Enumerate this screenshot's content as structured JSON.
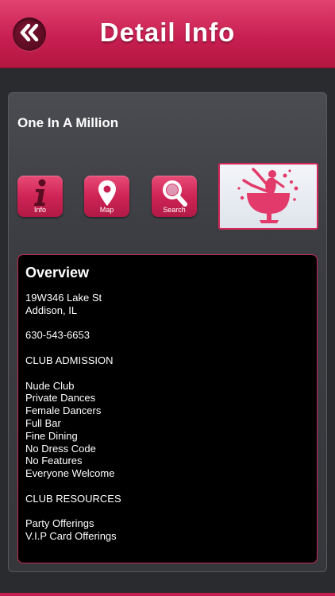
{
  "header": {
    "title": "Detail Info"
  },
  "club": {
    "name": "One In A Million"
  },
  "actions": {
    "info_label": "Info",
    "map_label": "Map",
    "search_label": "Search"
  },
  "icons": {
    "back": "double-chevron-left-icon",
    "info": "info-icon",
    "map": "map-pin-icon",
    "search": "magnifier-icon",
    "logo": "dancer-in-wineglass-logo"
  },
  "overview": {
    "title": "Overview",
    "lines": [
      "19W346 Lake St",
      "Addison, IL",
      "",
      "630-543-6653",
      "",
      "CLUB ADMISSION",
      "",
      "Nude Club",
      "Private Dances",
      "Female Dancers",
      "Full Bar",
      "Fine Dining",
      "No Dress Code",
      "No Features",
      "Everyone Welcome",
      "",
      "CLUB RESOURCES",
      "",
      "Party Offerings",
      "V.I.P Card Offerings"
    ]
  },
  "colors": {
    "accent": "#c81f52",
    "background": "#2a2b2f",
    "overview_bg": "#000000"
  }
}
